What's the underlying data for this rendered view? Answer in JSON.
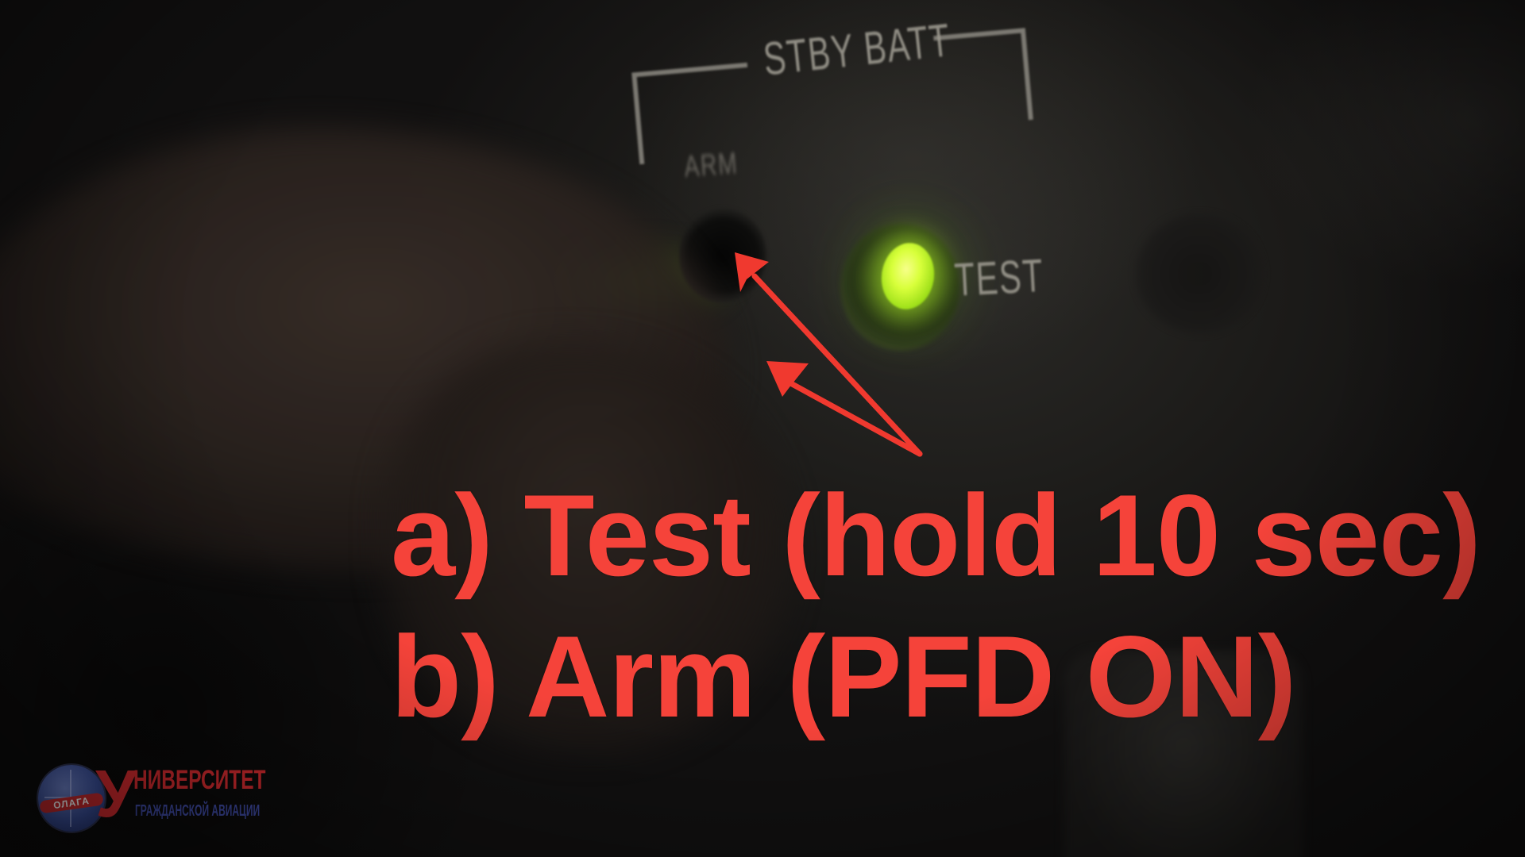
{
  "panel": {
    "section_label": "STBY BATT",
    "arm_label": "ARM",
    "test_label": "TEST"
  },
  "annotation": {
    "line_a": "a) Test (hold 10 sec)",
    "line_b": "b) Arm (PFD ON)",
    "color": "#f5433a"
  },
  "led": {
    "color": "#c8f53a",
    "state": "on"
  },
  "logo": {
    "ribbon": "ОЛАГА",
    "letter": "У",
    "title": "НИВЕРСИТЕТ",
    "subtitle": "ГРАЖДАНСКОЙ АВИАЦИИ"
  }
}
